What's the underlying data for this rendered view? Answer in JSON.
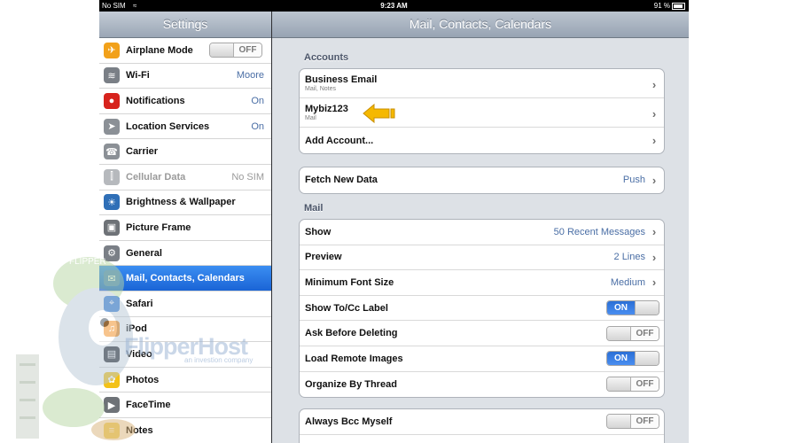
{
  "status_bar": {
    "carrier": "No SIM",
    "time": "9:23 AM",
    "battery": "91 %"
  },
  "sidebar": {
    "title": "Settings",
    "items": [
      {
        "label": "Airplane Mode",
        "toggle": "OFF",
        "icon": "airplane-icon",
        "color": "#f2a11a"
      },
      {
        "label": "Wi-Fi",
        "value": "Moore",
        "icon": "wifi-icon",
        "color": "#7a7f86"
      },
      {
        "label": "Notifications",
        "value": "On",
        "icon": "notifications-icon",
        "color": "#d7231d"
      },
      {
        "label": "Location Services",
        "value": "On",
        "icon": "location-icon",
        "color": "#8b9096"
      },
      {
        "label": "Carrier",
        "icon": "phone-icon",
        "color": "#8b9096"
      },
      {
        "label": "Cellular Data",
        "value": "No SIM",
        "icon": "cellular-icon",
        "color": "#b6b9bd",
        "disabled": true
      },
      {
        "label": "Brightness & Wallpaper",
        "icon": "brightness-icon",
        "color": "#2f6fb7"
      },
      {
        "label": "Picture Frame",
        "icon": "picture-frame-icon",
        "color": "#6e7277"
      },
      {
        "label": "General",
        "icon": "gear-icon",
        "color": "#7a7f86"
      },
      {
        "label": "Mail, Contacts, Calendars",
        "icon": "mail-icon",
        "color": "#4e84c8",
        "selected": true
      },
      {
        "label": "Safari",
        "icon": "compass-icon",
        "color": "#3b82d8"
      },
      {
        "label": "iPod",
        "icon": "music-icon",
        "color": "#f08a1a"
      },
      {
        "label": "Video",
        "icon": "film-icon",
        "color": "#2a2d33"
      },
      {
        "label": "Photos",
        "icon": "sunflower-icon",
        "color": "#f3c218"
      },
      {
        "label": "FaceTime",
        "icon": "facetime-icon",
        "color": "#6e7277"
      },
      {
        "label": "Notes",
        "icon": "notes-icon",
        "color": "#f1d86a"
      }
    ]
  },
  "main": {
    "title": "Mail, Contacts, Calendars",
    "accounts_title": "Accounts",
    "accounts": [
      {
        "name": "Business Email",
        "sub": "Mail, Notes"
      },
      {
        "name": "Mybiz123",
        "sub": "Mail"
      }
    ],
    "add_account": "Add Account...",
    "fetch": {
      "label": "Fetch New Data",
      "value": "Push"
    },
    "mail_title": "Mail",
    "mail_rows": [
      {
        "label": "Show",
        "value": "50 Recent Messages"
      },
      {
        "label": "Preview",
        "value": "2 Lines"
      },
      {
        "label": "Minimum Font Size",
        "value": "Medium"
      },
      {
        "label": "Show To/Cc Label",
        "toggle": "ON"
      },
      {
        "label": "Ask Before Deleting",
        "toggle": "OFF"
      },
      {
        "label": "Load Remote Images",
        "toggle": "ON"
      },
      {
        "label": "Organize By Thread",
        "toggle": "OFF"
      }
    ],
    "bcc": {
      "label": "Always Bcc Myself",
      "toggle": "OFF"
    }
  },
  "watermark": {
    "brand": "FlipperHost",
    "tagline": "an investion company",
    "badge": "FLIPPER"
  },
  "colors": {
    "selected": "#2a77e4",
    "value_blue": "#4a6ea5",
    "pointer": "#f5b800"
  }
}
